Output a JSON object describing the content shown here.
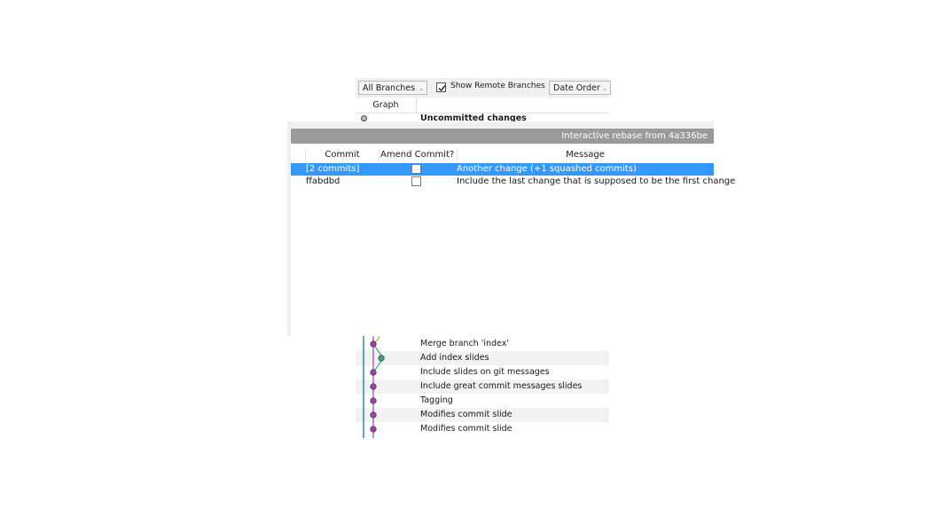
{
  "history": {
    "toolbar": {
      "branches_select": "All Branches",
      "show_remote_label": "Show Remote Branches",
      "show_remote_checked": true,
      "order_select": "Date Order"
    },
    "columns": {
      "graph": "Graph"
    },
    "uncommitted": "Uncommitted changes",
    "commits": [
      {
        "message": "Merge branch 'index'",
        "lane": "main"
      },
      {
        "message": "Add index slides",
        "lane": "branch"
      },
      {
        "message": "Include slides on git messages",
        "lane": "main"
      },
      {
        "message": "Include great commit messages slides",
        "lane": "main"
      },
      {
        "message": "Tagging",
        "lane": "main"
      },
      {
        "message": "Modifies commit slide",
        "lane": "main"
      },
      {
        "message": "Modifies commit slide",
        "lane": "main"
      }
    ],
    "colors": {
      "main": "#a43ea6",
      "branch": "#3aa47a",
      "yellow": "#c8a53a",
      "blue": "#2b8ab8"
    }
  },
  "rebase": {
    "title": "Interactive rebase from 4a336be",
    "columns": {
      "commit": "Commit",
      "amend": "Amend Commit?",
      "message": "Message"
    },
    "rows": [
      {
        "commit": "[2 commits]",
        "amend": false,
        "message": "Another change (+1 squashed commits)",
        "selected": true,
        "expandable": true
      },
      {
        "commit": "ffabdbd",
        "amend": false,
        "message": "Include the last change that is supposed to be the first change",
        "selected": false,
        "expandable": false
      }
    ],
    "selection_color": "#3399ff"
  }
}
